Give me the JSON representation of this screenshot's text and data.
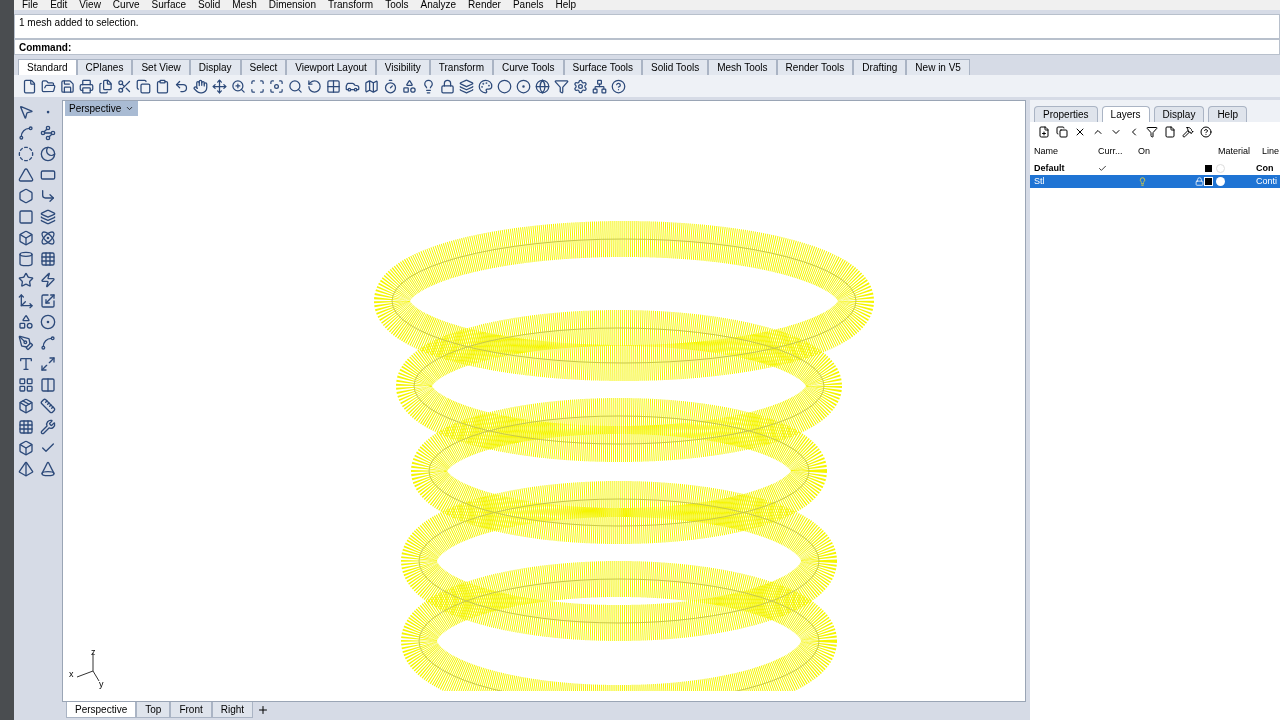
{
  "menu": [
    "File",
    "Edit",
    "View",
    "Curve",
    "Surface",
    "Solid",
    "Mesh",
    "Dimension",
    "Transform",
    "Tools",
    "Analyze",
    "Render",
    "Panels",
    "Help"
  ],
  "command_history": "1 mesh added to selection.",
  "command_prompt": "Command:",
  "toolbar_tabs": [
    {
      "label": "Standard",
      "selected": true
    },
    {
      "label": "CPlanes",
      "selected": false
    },
    {
      "label": "Set View",
      "selected": false
    },
    {
      "label": "Display",
      "selected": false
    },
    {
      "label": "Select",
      "selected": false
    },
    {
      "label": "Viewport Layout",
      "selected": false
    },
    {
      "label": "Visibility",
      "selected": false
    },
    {
      "label": "Transform",
      "selected": false
    },
    {
      "label": "Curve Tools",
      "selected": false
    },
    {
      "label": "Surface Tools",
      "selected": false
    },
    {
      "label": "Solid Tools",
      "selected": false
    },
    {
      "label": "Mesh Tools",
      "selected": false
    },
    {
      "label": "Render Tools",
      "selected": false
    },
    {
      "label": "Drafting",
      "selected": false
    },
    {
      "label": "New in V5",
      "selected": false
    }
  ],
  "viewport": {
    "title": "Perspective",
    "axes": [
      "z",
      "x",
      "y"
    ]
  },
  "viewport_tabs": [
    {
      "label": "Perspective",
      "selected": true
    },
    {
      "label": "Top",
      "selected": false
    },
    {
      "label": "Front",
      "selected": false
    },
    {
      "label": "Right",
      "selected": false
    }
  ],
  "panel_tabs": [
    {
      "label": "Properties",
      "selected": false
    },
    {
      "label": "Layers",
      "selected": true
    },
    {
      "label": "Display",
      "selected": false
    },
    {
      "label": "Help",
      "selected": false
    }
  ],
  "layers": {
    "columns": [
      "Name",
      "Curr...",
      "On",
      "Material",
      "Line"
    ],
    "rows": [
      {
        "name": "Default",
        "current": true,
        "selected": false,
        "on": false,
        "locked": false,
        "color": "#000000",
        "material": false,
        "linetype": "Con"
      },
      {
        "name": "Stl",
        "current": false,
        "selected": true,
        "on": true,
        "locked": true,
        "color": "#000000",
        "material": true,
        "linetype": "Conti"
      }
    ]
  }
}
